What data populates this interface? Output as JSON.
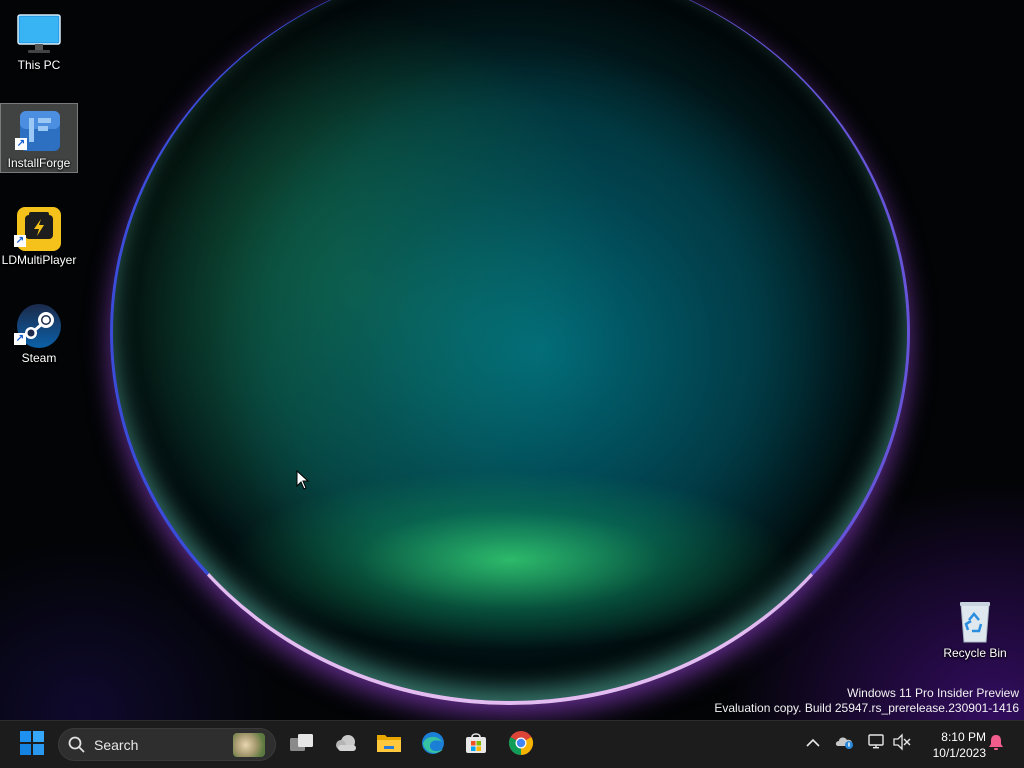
{
  "desktop": {
    "icons": [
      {
        "label": "This PC",
        "icon": "monitor-icon"
      },
      {
        "label": "InstallForge",
        "icon": "installforge-icon",
        "selected": true
      },
      {
        "label": "LDMultiPlayer",
        "icon": "ldmultiplayer-icon"
      },
      {
        "label": "Steam",
        "icon": "steam-icon"
      },
      {
        "label": "Recycle Bin",
        "icon": "recycle-bin-icon"
      }
    ],
    "watermark": {
      "line1": "Windows 11 Pro Insider Preview",
      "line2": "Evaluation copy. Build 25947.rs_prerelease.230901-1416"
    }
  },
  "taskbar": {
    "search_placeholder": "Search",
    "pinned": [
      "start-icon",
      "task-view-icon",
      "weather-icon",
      "file-explorer-icon",
      "edge-icon",
      "store-icon",
      "chrome-icon"
    ],
    "tray_icons": [
      "chevron-up-icon",
      "onedrive-icon",
      "network-icon",
      "volume-muted-icon",
      "notification-bell-icon"
    ],
    "clock": {
      "time": "8:10 PM",
      "date": "10/1/2023"
    }
  },
  "colors": {
    "accent": "#0078d4",
    "taskbar_bg": "#1c1c1c"
  }
}
